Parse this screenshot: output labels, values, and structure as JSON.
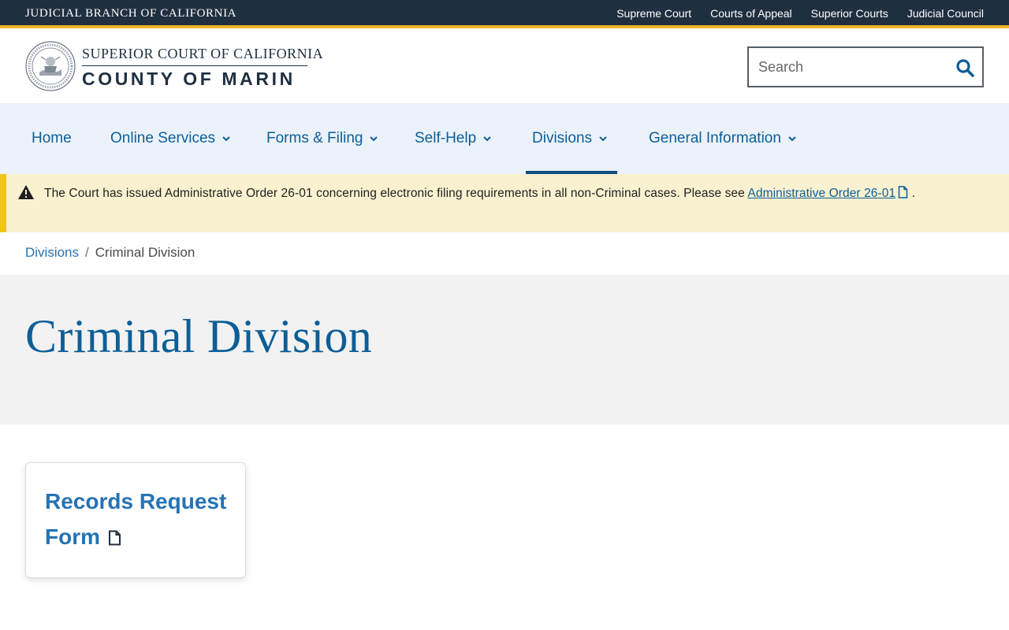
{
  "topbar": {
    "branch_title": "JUDICIAL BRANCH OF CALIFORNIA",
    "links": [
      "Supreme Court",
      "Courts of Appeal",
      "Superior Courts",
      "Judicial Council"
    ]
  },
  "header": {
    "brand_line1": "SUPERIOR COURT OF CALIFORNIA",
    "brand_line2": "COUNTY OF MARIN",
    "search_placeholder": "Search"
  },
  "nav": {
    "items": [
      "Home",
      "Online Services",
      "Forms & Filing",
      "Self-Help",
      "Divisions",
      "General Information"
    ],
    "active": "Divisions"
  },
  "alert": {
    "text": "The Court has issued Administrative Order 26-01 concerning electronic filing requirements in all non-Criminal cases. Please see ",
    "link_text": "Administrative Order 26-01",
    "trailing": "."
  },
  "breadcrumb": {
    "parent": "Divisions",
    "separator": "/",
    "current": "Criminal Division"
  },
  "page": {
    "title": "Criminal Division"
  },
  "cards": [
    {
      "label": "Records Request Form",
      "icon": "file-icon"
    }
  ],
  "colors": {
    "topbar_bg": "#1f2f40",
    "accent_gold": "#f0b429",
    "nav_bg": "#ebf2f9",
    "link_blue": "#0e5e97",
    "alert_bg": "#f9f1d0",
    "hero_bg": "#f2f2f2"
  }
}
